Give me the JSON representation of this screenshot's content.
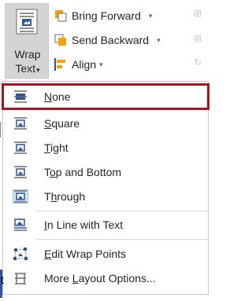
{
  "ribbon": {
    "wrap_text_label_line1": "Wrap",
    "wrap_text_label_line2": "Text",
    "wrap_text_dropdown": "▾",
    "bring_forward_label": "Bring Forward",
    "send_backward_label": "Send Backward",
    "align_label": "Align",
    "dropdown_glyph": "▾"
  },
  "menu": {
    "items": [
      {
        "label_pre": "",
        "label_key": "N",
        "label_post": "one",
        "icon": "wrap-none-icon",
        "selected": true
      },
      {
        "label_pre": "",
        "label_key": "S",
        "label_post": "quare",
        "icon": "wrap-square-icon"
      },
      {
        "label_pre": "",
        "label_key": "T",
        "label_post": "ight",
        "icon": "wrap-tight-icon"
      },
      {
        "label_pre": "T",
        "label_key": "o",
        "label_post": "p and Bottom",
        "icon": "wrap-top-bottom-icon"
      },
      {
        "label_pre": "T",
        "label_key": "h",
        "label_post": "rough",
        "icon": "wrap-through-icon"
      },
      {
        "label_pre": "",
        "label_key": "I",
        "label_post": "n Line with Text",
        "icon": "wrap-inline-icon"
      },
      {
        "label_pre": "",
        "label_key": "E",
        "label_post": "dit Wrap Points",
        "icon": "edit-wrap-points-icon"
      },
      {
        "label_pre": "More ",
        "label_key": "L",
        "label_post": "ayout Options...",
        "icon": "layout-options-icon"
      }
    ]
  },
  "colors": {
    "selected_border": "#a4151d",
    "wrap_button_bg": "#d4d4d4",
    "icon_blue": "#2b579a",
    "icon_orange": "#f0a30a"
  },
  "edge_char": "t"
}
